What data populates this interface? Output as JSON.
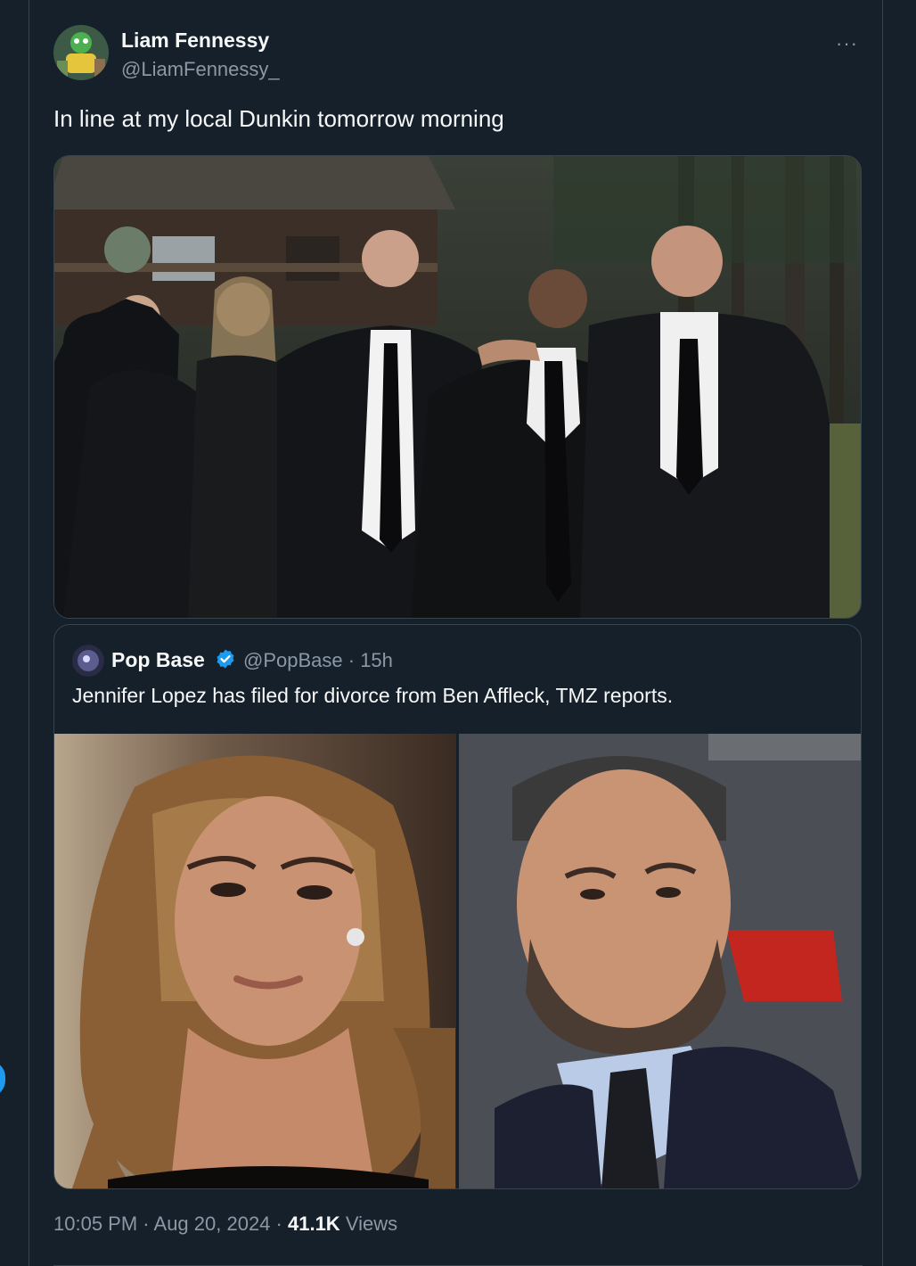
{
  "author": {
    "name": "Liam Fennessy",
    "handle": "@LiamFennessy_"
  },
  "more_label": "···",
  "tweet_text": "In line at my local Dunkin tomorrow morning",
  "quoted": {
    "name": "Pop Base",
    "handle": "@PopBase",
    "separator": " · ",
    "time": "15h",
    "text": "Jennifer Lopez has filed for divorce from Ben Affleck, TMZ reports."
  },
  "footer": {
    "time": "10:05 PM",
    "sep1": " · ",
    "date": "Aug 20, 2024",
    "sep2": " · ",
    "views_count": "41.1K",
    "views_label": " Views"
  },
  "colors": {
    "background": "#15202b",
    "border": "#38444d",
    "text_primary": "#f7f9f9",
    "text_secondary": "#8b98a5",
    "verified_badge": "#1d9bf0"
  }
}
